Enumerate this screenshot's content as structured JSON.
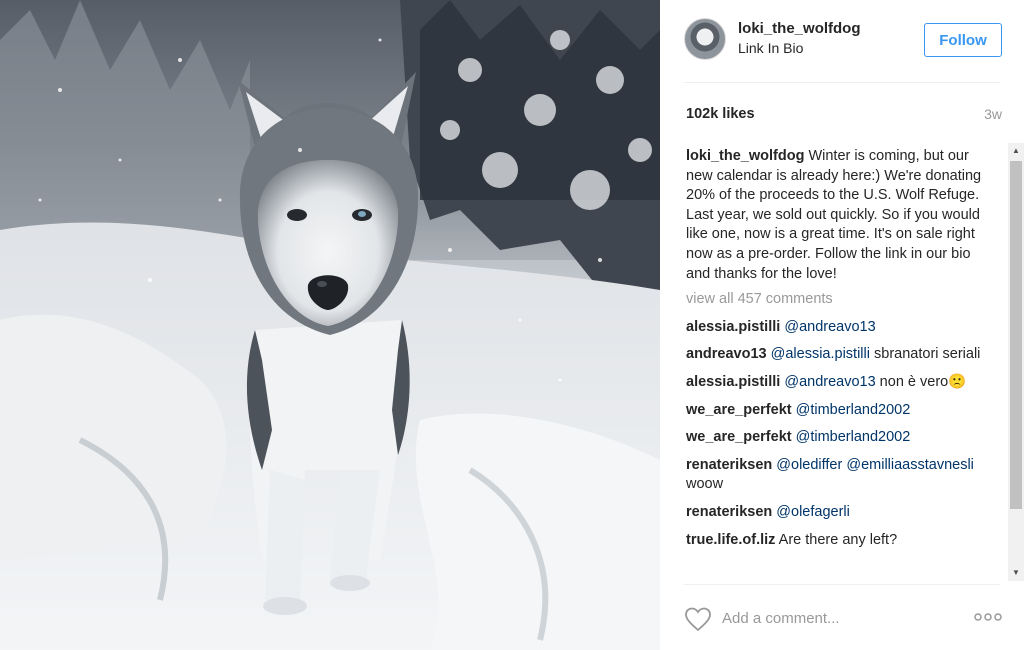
{
  "post": {
    "image_description_icon": "wolfdog-photo",
    "header": {
      "username": "loki_the_wolfdog",
      "location": "Link In Bio",
      "follow_label": "Follow"
    },
    "likes": "102k likes",
    "age": "3w",
    "caption": {
      "user": "loki_the_wolfdog",
      "text": "Winter is coming, but our new calendar is already here:) We're donating 20% of the proceeds to the U.S. Wolf Refuge. Last year, we sold out quickly. So if you would like one, now is a great time. It's on sale right now as a pre-order. Follow the link in our bio and thanks for the love!"
    },
    "view_all": "view all 457 comments",
    "comments": [
      {
        "user": "alessia.pistilli",
        "mention": "@andreavo13",
        "text": ""
      },
      {
        "user": "andreavo13",
        "mention": "@alessia.pistilli",
        "text": " sbranatori seriali"
      },
      {
        "user": "alessia.pistilli",
        "mention": "@andreavo13",
        "text": " non è vero🙁"
      },
      {
        "user": "we_are_perfekt",
        "mention": "@timberland2002",
        "text": ""
      },
      {
        "user": "we_are_perfekt",
        "mention": "@timberland2002",
        "text": ""
      },
      {
        "user": "renateriksen",
        "mention": "@olediffer",
        "mention2": "@emilliaasstavnesli",
        "text": " woow"
      },
      {
        "user": "renateriksen",
        "mention": "@olefagerli",
        "text": ""
      },
      {
        "user": "true.life.of.liz",
        "mention": "",
        "text": "Are there any left?"
      }
    ],
    "comment_placeholder": "Add a comment...",
    "icons": {
      "like": "heart-outline-icon",
      "more": "more-options-icon",
      "scroll_up": "scroll-up-arrow-icon",
      "scroll_down": "scroll-down-arrow-icon"
    },
    "colors": {
      "follow_blue": "#3897f0",
      "mention_blue": "#003569",
      "muted_gray": "#999999"
    }
  }
}
